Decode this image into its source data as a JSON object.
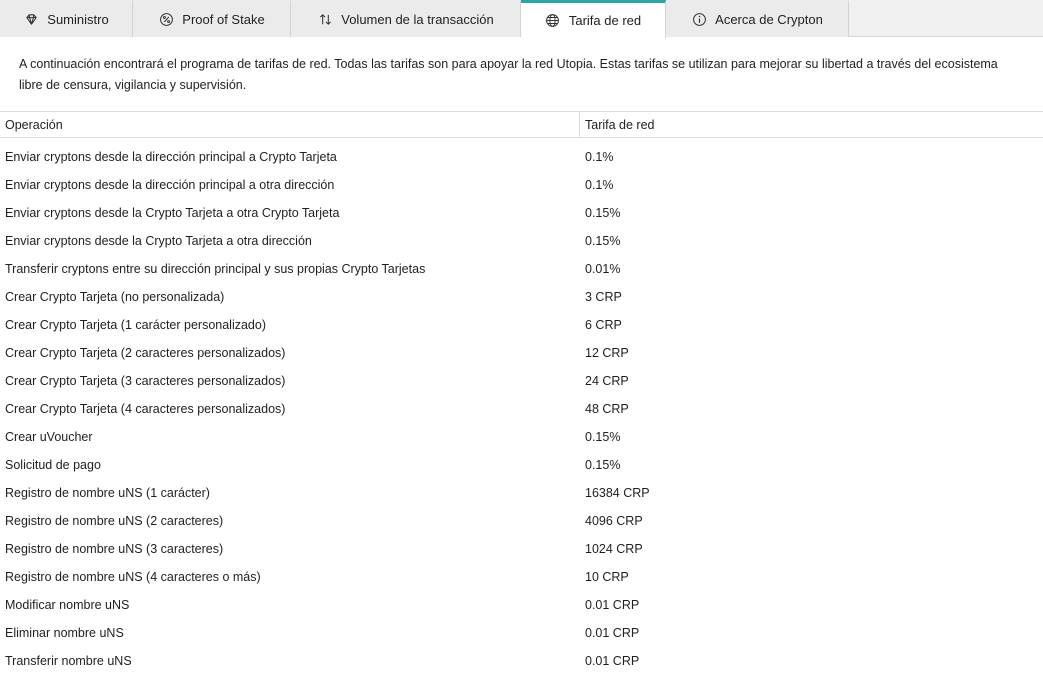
{
  "tabs": [
    {
      "label": "Suministro",
      "icon": "diamond-icon",
      "active": false
    },
    {
      "label": "Proof of Stake",
      "icon": "percent-icon",
      "active": false
    },
    {
      "label": "Volumen de la transacción",
      "icon": "sort-arrows-icon",
      "active": false
    },
    {
      "label": "Tarifa de red",
      "icon": "globe-icon",
      "active": true
    },
    {
      "label": "Acerca de Crypton",
      "icon": "info-icon",
      "active": false
    }
  ],
  "accent_color": "#2aa6a6",
  "intro_text": "A continuación encontrará el programa de tarifas de red. Todas las tarifas son para apoyar la red Utopia. Estas tarifas se utilizan para mejorar su libertad a través del ecosistema libre de censura, vigilancia y supervisión.",
  "table": {
    "headers": {
      "operation": "Operación",
      "fee": "Tarifa de red"
    },
    "rows": [
      {
        "operation": "Enviar cryptons desde la dirección principal a Crypto Tarjeta",
        "fee": "0.1%"
      },
      {
        "operation": "Enviar cryptons desde la dirección principal a otra dirección",
        "fee": "0.1%"
      },
      {
        "operation": "Enviar cryptons desde la Crypto Tarjeta a otra Crypto Tarjeta",
        "fee": "0.15%"
      },
      {
        "operation": "Enviar cryptons desde la Crypto Tarjeta a otra dirección",
        "fee": "0.15%"
      },
      {
        "operation": "Transferir cryptons entre su dirección principal y sus propias Crypto Tarjetas",
        "fee": "0.01%"
      },
      {
        "operation": "Crear Crypto Tarjeta (no personalizada)",
        "fee": "3 CRP"
      },
      {
        "operation": "Crear Crypto Tarjeta (1 carácter personalizado)",
        "fee": "6 CRP"
      },
      {
        "operation": "Crear Crypto Tarjeta (2 caracteres personalizados)",
        "fee": "12 CRP"
      },
      {
        "operation": "Crear Crypto Tarjeta (3 caracteres personalizados)",
        "fee": "24 CRP"
      },
      {
        "operation": "Crear Crypto Tarjeta (4 caracteres personalizados)",
        "fee": "48 CRP"
      },
      {
        "operation": "Crear uVoucher",
        "fee": "0.15%"
      },
      {
        "operation": "Solicitud de pago",
        "fee": "0.15%"
      },
      {
        "operation": "Registro de nombre uNS (1 carácter)",
        "fee": "16384 CRP"
      },
      {
        "operation": "Registro de nombre uNS (2 caracteres)",
        "fee": "4096 CRP"
      },
      {
        "operation": "Registro de nombre uNS (3 caracteres)",
        "fee": "1024 CRP"
      },
      {
        "operation": "Registro de nombre uNS (4 caracteres o más)",
        "fee": "10 CRP"
      },
      {
        "operation": "Modificar nombre uNS",
        "fee": "0.01 CRP"
      },
      {
        "operation": "Eliminar nombre uNS",
        "fee": "0.01 CRP"
      },
      {
        "operation": "Transferir nombre uNS",
        "fee": "0.01 CRP"
      }
    ]
  }
}
